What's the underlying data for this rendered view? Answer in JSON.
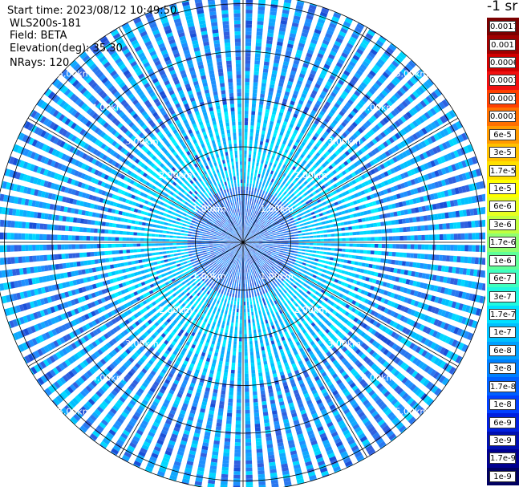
{
  "header": {
    "start_time": "Start time: 2023/08/12 10:49:50",
    "instrument": "WLS200s-181",
    "field": "Field: BETA",
    "elevation": "Elevation(deg): 35.30",
    "nrays": "NRays: 120"
  },
  "chart_data": {
    "type": "heatmap",
    "projection": "polar (PPI scan)",
    "field": "BETA",
    "n_rays": 120,
    "range_rings_km": [
      1,
      2,
      3,
      4,
      5
    ],
    "ring_labels": [
      "1.00km",
      "2.00km",
      "3.00km",
      "4.00km",
      "5.00km"
    ],
    "max_range_km": 5.2,
    "spoke_angles_deg": [
      0,
      30,
      60,
      90,
      120,
      150,
      180,
      210,
      240,
      270,
      300,
      330
    ],
    "colorbar": {
      "unit_title": "-1 sr",
      "tick_labels": [
        "0.0017",
        "0.001",
        "0.0006",
        "0.0003",
        "0.00017",
        "0.0001",
        "6e-5",
        "3e-5",
        "1.7e-5",
        "1e-5",
        "6e-6",
        "3e-6",
        "1.7e-6",
        "1e-6",
        "6e-7",
        "3e-7",
        "1.7e-7",
        "1e-7",
        "6e-8",
        "3e-8",
        "1.7e-8",
        "1e-8",
        "6e-9",
        "3e-9",
        "1.7e-9",
        "1e-9"
      ],
      "colors": [
        "#7a0000",
        "#a00000",
        "#d00000",
        "#f01010",
        "#ff4000",
        "#ff7000",
        "#ff9a00",
        "#ffc000",
        "#ffe000",
        "#ffff00",
        "#e8ff20",
        "#c0ff40",
        "#90ff70",
        "#60ff98",
        "#40ffc0",
        "#20f8e0",
        "#00e0ff",
        "#00c0ff",
        "#00a0ff",
        "#0080ff",
        "#0060ff",
        "#0040ff",
        "#0020e0",
        "#0010b0",
        "#000090",
        "#000060"
      ]
    },
    "dominant_beta_range": [
      "1e-8",
      "1e-7"
    ],
    "grid": true
  }
}
